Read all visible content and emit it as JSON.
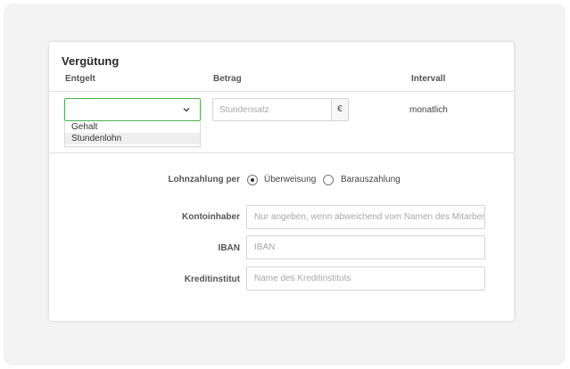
{
  "section": {
    "title": "Vergütung"
  },
  "columns": {
    "entgelt": "Entgelt",
    "betrag": "Betrag",
    "intervall": "Intervall"
  },
  "entgelt_select": {
    "selected": "",
    "options": [
      "Gehalt",
      "Stundenlohn"
    ],
    "hovered_option": "Stundenlohn"
  },
  "betrag": {
    "placeholder": "Stundensatz",
    "value": "",
    "currency": "€"
  },
  "intervall": {
    "value": "monatlich"
  },
  "lohnzahlung": {
    "label": "Lohnzahlung per",
    "options": [
      {
        "label": "Überweisung",
        "checked": true
      },
      {
        "label": "Barauszahlung",
        "checked": false
      }
    ]
  },
  "fields": {
    "kontoinhaber": {
      "label": "Kontoinhaber",
      "placeholder": "Nur angeben, wenn abweichend vom Namen des Mitarbeiters"
    },
    "iban": {
      "label": "IBAN",
      "placeholder": "IBAN"
    },
    "kreditinstitut": {
      "label": "Kreditinstitut",
      "placeholder": "Name des Kreditinstituts"
    }
  },
  "icons": {
    "select_chevron": "chevron-down-icon"
  },
  "colors": {
    "select_focus_border": "#4caf50",
    "background": "#f3f3f3",
    "card": "#ffffff"
  }
}
